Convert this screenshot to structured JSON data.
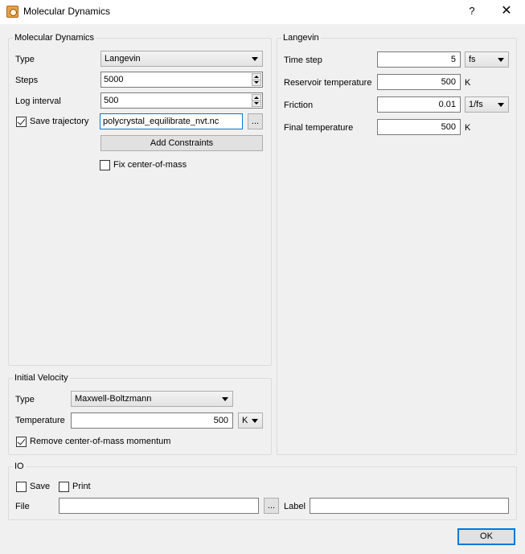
{
  "window": {
    "title": "Molecular Dynamics",
    "help_label": "?",
    "close_label": "✕",
    "app_icon": "molecule-app-icon"
  },
  "md": {
    "title": "Molecular Dynamics",
    "type_label": "Type",
    "type_value": "Langevin",
    "steps_label": "Steps",
    "steps_value": "5000",
    "log_interval_label": "Log interval",
    "log_interval_value": "500",
    "save_trajectory_label": "Save trajectory",
    "save_trajectory_checked": true,
    "trajectory_file": "polycrystal_equilibrate_nvt.nc",
    "browse_label": "...",
    "add_constraints_label": "Add Constraints",
    "fix_com_label": "Fix center-of-mass",
    "fix_com_checked": false
  },
  "langevin": {
    "title": "Langevin",
    "time_step_label": "Time step",
    "time_step_value": "5",
    "time_step_unit": "fs",
    "reservoir_temp_label": "Reservoir temperature",
    "reservoir_temp_value": "500",
    "reservoir_temp_unit": "K",
    "friction_label": "Friction",
    "friction_value": "0.01",
    "friction_unit": "1/fs",
    "final_temp_label": "Final temperature",
    "final_temp_value": "500",
    "final_temp_unit": "K"
  },
  "velocity": {
    "title": "Initial Velocity",
    "type_label": "Type",
    "type_value": "Maxwell-Boltzmann",
    "temperature_label": "Temperature",
    "temperature_value": "500",
    "temperature_unit": "K",
    "remove_com_label": "Remove center-of-mass momentum",
    "remove_com_checked": true
  },
  "io": {
    "title": "IO",
    "save_label": "Save",
    "save_checked": false,
    "print_label": "Print",
    "print_checked": false,
    "file_label": "File",
    "file_value": "",
    "browse_label": "...",
    "label_label": "Label",
    "label_value": ""
  },
  "footer": {
    "ok_label": "OK"
  }
}
